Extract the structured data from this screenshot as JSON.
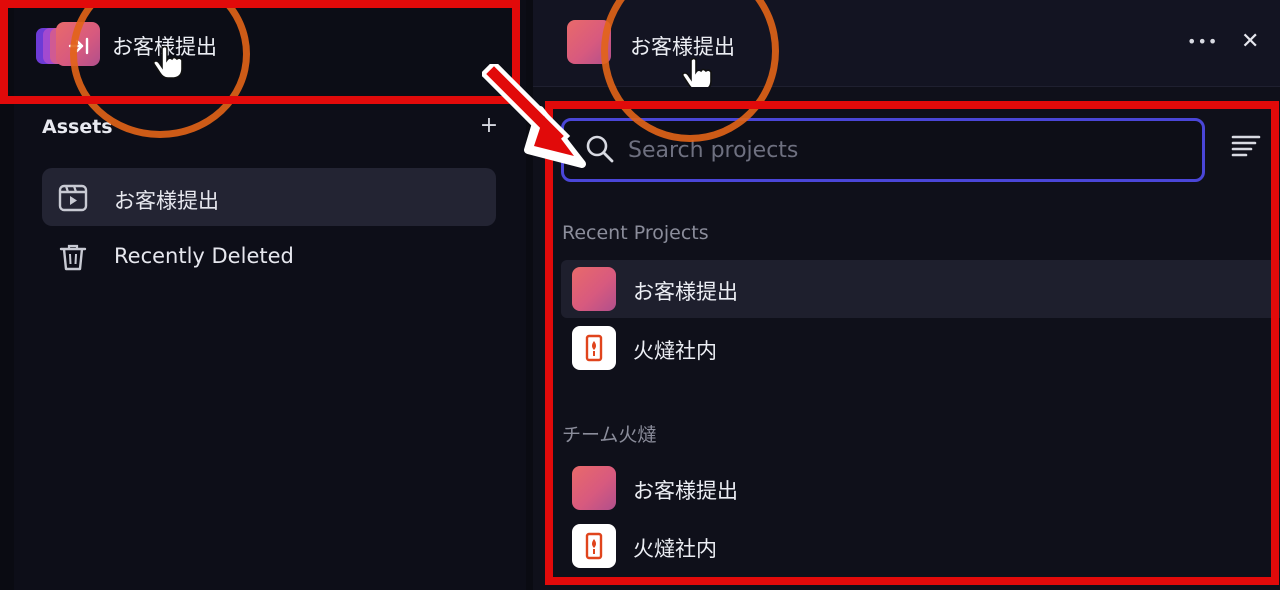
{
  "left_panel": {
    "header": {
      "workspace_name": "お客様提出"
    },
    "assets": {
      "title": "Assets",
      "add_symbol": "+",
      "items": [
        {
          "label": "お客様提出",
          "icon": "project-folder-icon",
          "active": true
        },
        {
          "label": "Recently Deleted",
          "icon": "trash-icon",
          "active": false
        }
      ]
    }
  },
  "right_panel": {
    "header": {
      "project_name": "お客様提出",
      "more_symbol": "•••",
      "close_symbol": "✕"
    },
    "search": {
      "placeholder": "Search projects",
      "value": ""
    },
    "sections": [
      {
        "label": "Recent Projects",
        "projects": [
          {
            "name": "お客様提出",
            "thumb": "gradient",
            "active": true
          },
          {
            "name": "火燵社内",
            "thumb": "logo",
            "active": false
          }
        ]
      },
      {
        "label": "チーム火燵",
        "projects": [
          {
            "name": "お客様提出",
            "thumb": "gradient",
            "active": false
          },
          {
            "name": "火燵社内",
            "thumb": "logo",
            "active": false
          }
        ]
      }
    ]
  },
  "colors": {
    "annotation_red": "#e10a0a",
    "annotation_orange": "#e26417",
    "focus_blue": "#4a46d8",
    "project_gradient_start": "#e96a6a",
    "project_gradient_end": "#b14f8c",
    "logo_red": "#e0441c"
  }
}
